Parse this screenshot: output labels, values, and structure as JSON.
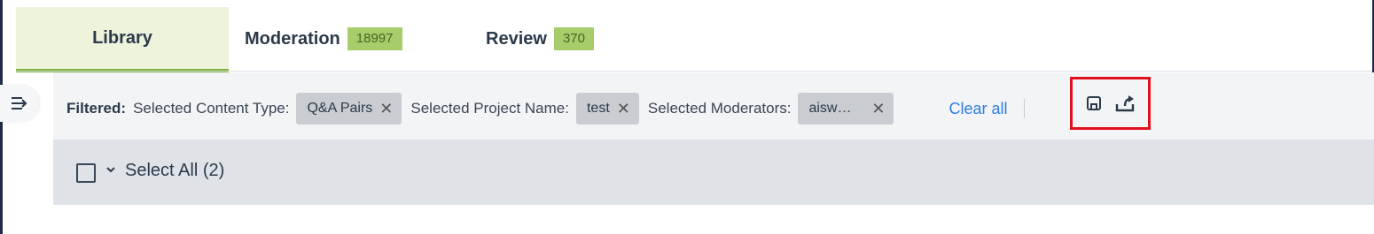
{
  "tabs": [
    {
      "label": "Library",
      "count": null
    },
    {
      "label": "Moderation",
      "count": "18997"
    },
    {
      "label": "Review",
      "count": "370"
    }
  ],
  "filters": {
    "filtered_label": "Filtered:",
    "content_type_label": "Selected Content Type:",
    "content_type_value": "Q&A Pairs",
    "project_label": "Selected Project Name:",
    "project_value": "test",
    "moderators_label": "Selected Moderators:",
    "moderators_value": "aisw…",
    "clear_all": "Clear all"
  },
  "icons": {
    "sidebar_toggle": "sidebar-toggle-icon",
    "save": "save-icon",
    "export": "export-icon",
    "chip_remove": "close-icon",
    "chevron": "chevron-down-icon"
  },
  "select_all": {
    "label": "Select All",
    "count": "(2)"
  },
  "colors": {
    "accent_green": "#7fb13a",
    "badge_bg": "#a7cc6a",
    "link_blue": "#2b7de0",
    "highlight_red": "#e0101c"
  }
}
